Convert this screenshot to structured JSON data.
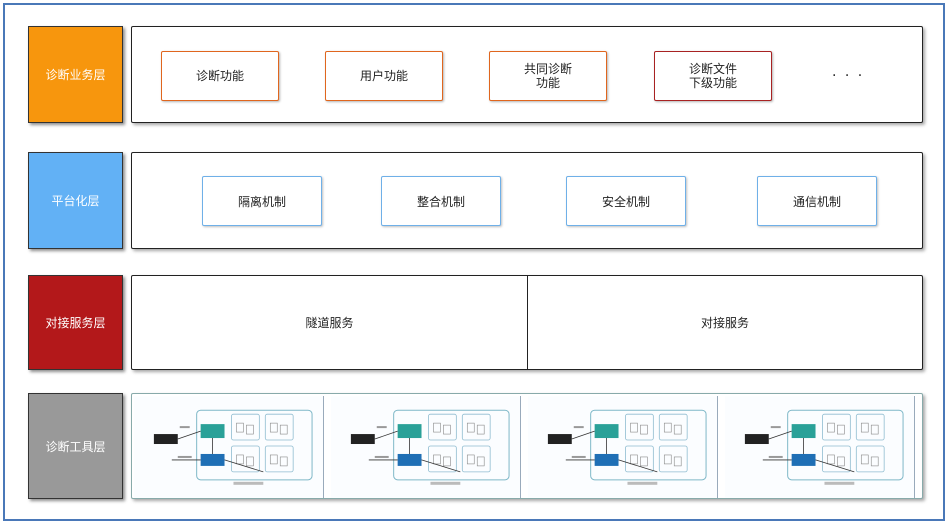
{
  "layers": [
    {
      "label": "诊断业务层",
      "color": "#f7960d"
    },
    {
      "label": "平台化层",
      "color": "#62b1f5"
    },
    {
      "label": "对接服务层",
      "color": "#b3181a"
    },
    {
      "label": "诊断工具层",
      "color": "#999999"
    }
  ],
  "business": {
    "items": [
      "诊断功能",
      "用户功能",
      "共同诊断\n功能",
      "诊断文件\n下级功能"
    ],
    "more": "· · ·"
  },
  "platform": {
    "items": [
      "隔离机制",
      "整合机制",
      "安全机制",
      "通信机制"
    ]
  },
  "service": {
    "left": "隧道服务",
    "right": "对接服务"
  },
  "tools": {
    "thumbnail_count": 4
  },
  "colors": {
    "frame": "#4a78b8",
    "business_border": "#e0661e",
    "business_border_alt": "#a82222",
    "platform_border": "#6fb0e8",
    "tool_teal": "#2aa198",
    "tool_blue": "#1f6fb5"
  }
}
